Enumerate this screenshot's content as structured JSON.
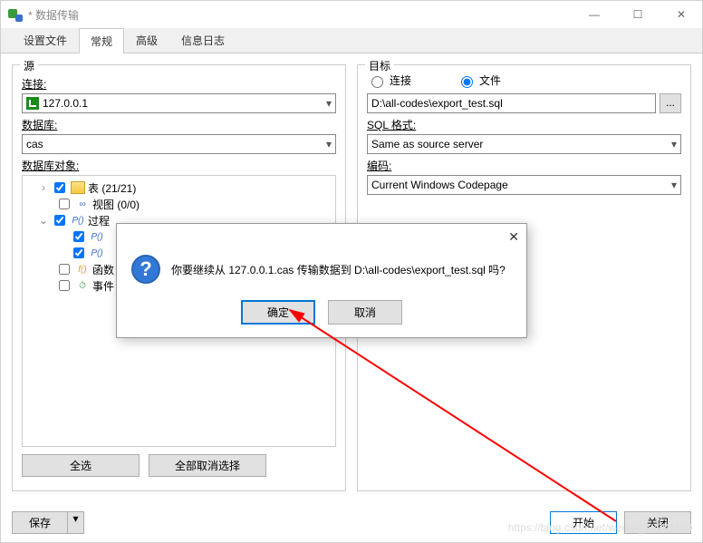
{
  "window": {
    "title": "* 数据传输"
  },
  "winbtns": {
    "min": "—",
    "max": "☐",
    "close": "✕"
  },
  "tabs": {
    "settings": "设置文件",
    "general": "常规",
    "advanced": "高级",
    "log": "信息日志"
  },
  "source": {
    "title": "源",
    "connection_label": "连接:",
    "connection_value": "127.0.0.1",
    "database_label": "数据库:",
    "database_value": "cas",
    "objects_label": "数据库对象:",
    "items": {
      "tables": "表  (21/21)",
      "views": "视图  (0/0)",
      "procs": "过程",
      "p0a": "P()",
      "p0b": "P()",
      "funcs": "函数",
      "events": "事件"
    },
    "select_all": "全选",
    "deselect_all": "全部取消选择"
  },
  "target": {
    "title": "目标",
    "radio_conn": "连接",
    "radio_file": "文件",
    "file_value": "D:\\all-codes\\export_test.sql",
    "sql_format_label": "SQL 格式:",
    "sql_format_value": "Same as source server",
    "encoding_label": "编码:",
    "encoding_value": "Current Windows Codepage"
  },
  "footer": {
    "save": "保存",
    "start": "开始",
    "close": "关闭"
  },
  "dialog": {
    "message": "你要继续从 127.0.0.1.cas 传输数据到 D:\\all-codes\\export_test.sql 吗?",
    "ok": "确定",
    "cancel": "取消"
  },
  "watermark": "https://blog.csdn.net/weixin_42201180"
}
